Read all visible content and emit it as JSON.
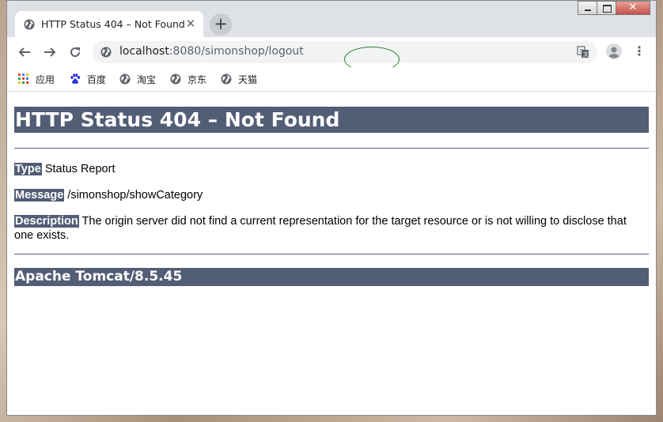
{
  "browser": {
    "tab": {
      "title": "HTTP Status 404 – Not Found"
    },
    "url": {
      "host": "localhost",
      "rest": ":8080/simonshop/logout"
    },
    "bookmarks": [
      {
        "label": "应用",
        "icon": "apps-grid-icon"
      },
      {
        "label": "百度",
        "icon": "baidu-paw-icon"
      },
      {
        "label": "淘宝",
        "icon": "globe-icon"
      },
      {
        "label": "京东",
        "icon": "globe-icon"
      },
      {
        "label": "天猫",
        "icon": "globe-icon"
      }
    ]
  },
  "page": {
    "heading": "HTTP Status 404 – Not Found",
    "type_label": "Type",
    "type_value": "Status Report",
    "message_label": "Message",
    "message_value": "/simonshop/showCategory",
    "description_label": "Description",
    "description_value": "The origin server did not find a current representation for the target resource or is not willing to disclose that one exists.",
    "footer": "Apache Tomcat/8.5.45"
  },
  "colors": {
    "tomcat_header": "#525d76",
    "annotation_ellipse": "#2e7d32"
  }
}
